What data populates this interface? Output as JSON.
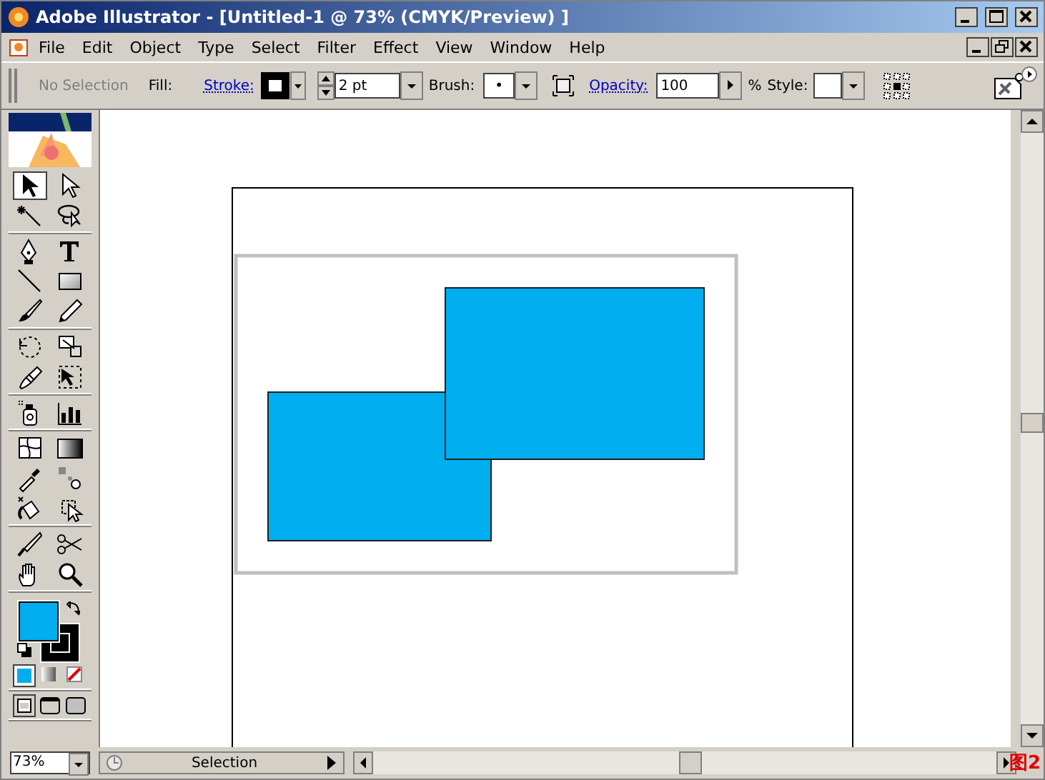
{
  "window": {
    "title": "Adobe Illustrator - [Untitled-1 @ 73% (CMYK/Preview) ]"
  },
  "menu": [
    {
      "label": "File"
    },
    {
      "label": "Edit"
    },
    {
      "label": "Object"
    },
    {
      "label": "Type"
    },
    {
      "label": "Select"
    },
    {
      "label": "Filter"
    },
    {
      "label": "Effect"
    },
    {
      "label": "View"
    },
    {
      "label": "Window"
    },
    {
      "label": "Help"
    }
  ],
  "control_bar": {
    "selection": "No Selection",
    "fill_label": "Fill:",
    "stroke_label": "Stroke:",
    "stroke_weight": "2 pt",
    "brush_label": "Brush:",
    "brush_value": "•",
    "opacity_label": "Opacity:",
    "opacity_value": "100",
    "percent": "%",
    "style_label": "Style:"
  },
  "tool_groups": [
    [
      {
        "kind": "arrow",
        "selected": true
      },
      {
        "kind": "direct",
        "selected": false
      },
      {
        "kind": "wand",
        "selected": false
      },
      {
        "kind": "lasso",
        "selected": false
      }
    ],
    [
      {
        "kind": "pen",
        "selected": false
      },
      {
        "kind": "type",
        "selected": false
      },
      {
        "kind": "line",
        "selected": false
      },
      {
        "kind": "rect",
        "selected": false
      },
      {
        "kind": "brush",
        "selected": false
      },
      {
        "kind": "pencil",
        "selected": false
      }
    ],
    [
      {
        "kind": "rotate",
        "selected": false
      },
      {
        "kind": "scale",
        "selected": false
      },
      {
        "kind": "warp",
        "selected": false
      },
      {
        "kind": "free",
        "selected": false
      }
    ],
    [
      {
        "kind": "symbol",
        "selected": false
      },
      {
        "kind": "graph",
        "selected": false
      }
    ],
    [
      {
        "kind": "mesh",
        "selected": false
      },
      {
        "kind": "gradient",
        "selected": false
      },
      {
        "kind": "eyedropper",
        "selected": false
      },
      {
        "kind": "blend",
        "selected": false
      },
      {
        "kind": "bucket",
        "selected": false
      },
      {
        "kind": "bucketsel",
        "selected": false
      }
    ],
    [
      {
        "kind": "knife",
        "selected": false
      },
      {
        "kind": "scissors",
        "selected": false
      },
      {
        "kind": "hand",
        "selected": false
      },
      {
        "kind": "zoom",
        "selected": false
      }
    ]
  ],
  "zoom": "73%",
  "status": "Selection",
  "figure_label": "图2"
}
